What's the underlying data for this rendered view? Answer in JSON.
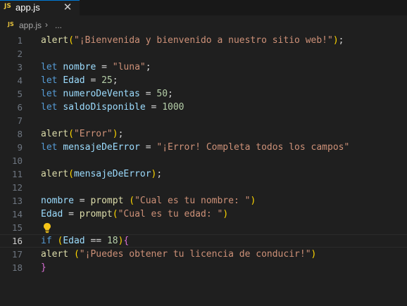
{
  "tab": {
    "badge": "JS",
    "name": "app.js",
    "close": "✕"
  },
  "breadcrumb": {
    "badge": "JS",
    "file": "app.js",
    "separator": "›",
    "more": "..."
  },
  "editor": {
    "current_line": 16,
    "lines": [
      {
        "n": "1",
        "tokens": [
          [
            "fn",
            "alert"
          ],
          [
            "p1",
            "("
          ],
          [
            "str",
            "\"¡Bienvenida y bienvenido a nuestro sitio web!\""
          ],
          [
            "p1",
            ")"
          ],
          [
            "plain",
            ";"
          ]
        ]
      },
      {
        "n": "2",
        "tokens": []
      },
      {
        "n": "3",
        "tokens": [
          [
            "kw",
            "let"
          ],
          [
            "plain",
            " "
          ],
          [
            "var",
            "nombre"
          ],
          [
            "op",
            " = "
          ],
          [
            "str",
            "\"luna\""
          ],
          [
            "plain",
            ";"
          ]
        ]
      },
      {
        "n": "4",
        "tokens": [
          [
            "kw",
            "let"
          ],
          [
            "plain",
            " "
          ],
          [
            "var",
            "Edad"
          ],
          [
            "op",
            " = "
          ],
          [
            "num",
            "25"
          ],
          [
            "plain",
            ";"
          ]
        ]
      },
      {
        "n": "5",
        "tokens": [
          [
            "kw",
            "let"
          ],
          [
            "plain",
            " "
          ],
          [
            "var",
            "numeroDeVentas"
          ],
          [
            "op",
            " = "
          ],
          [
            "num",
            "50"
          ],
          [
            "plain",
            ";"
          ]
        ]
      },
      {
        "n": "6",
        "tokens": [
          [
            "kw",
            "let"
          ],
          [
            "plain",
            " "
          ],
          [
            "var",
            "saldoDisponible"
          ],
          [
            "op",
            " = "
          ],
          [
            "num",
            "1000"
          ]
        ]
      },
      {
        "n": "7",
        "tokens": []
      },
      {
        "n": "8",
        "tokens": [
          [
            "fn",
            "alert"
          ],
          [
            "p1",
            "("
          ],
          [
            "str",
            "\"Error\""
          ],
          [
            "p1",
            ")"
          ],
          [
            "plain",
            ";"
          ]
        ]
      },
      {
        "n": "9",
        "tokens": [
          [
            "kw",
            "let"
          ],
          [
            "plain",
            " "
          ],
          [
            "var",
            "mensajeDeError"
          ],
          [
            "op",
            " = "
          ],
          [
            "str",
            "\"¡Error! Completa todos los campos\""
          ]
        ]
      },
      {
        "n": "10",
        "tokens": []
      },
      {
        "n": "11",
        "tokens": [
          [
            "fn",
            "alert"
          ],
          [
            "p1",
            "("
          ],
          [
            "var",
            "mensajeDeError"
          ],
          [
            "p1",
            ")"
          ],
          [
            "plain",
            ";"
          ]
        ]
      },
      {
        "n": "12",
        "tokens": []
      },
      {
        "n": "13",
        "tokens": [
          [
            "var",
            "nombre"
          ],
          [
            "op",
            " = "
          ],
          [
            "fn",
            "prompt"
          ],
          [
            "plain",
            " "
          ],
          [
            "p1",
            "("
          ],
          [
            "str",
            "\"Cual es tu nombre: \""
          ],
          [
            "p1",
            ")"
          ]
        ]
      },
      {
        "n": "14",
        "tokens": [
          [
            "var",
            "Edad"
          ],
          [
            "op",
            " = "
          ],
          [
            "fn",
            "prompt"
          ],
          [
            "p1",
            "("
          ],
          [
            "str",
            "\"Cual es tu edad: \""
          ],
          [
            "p1",
            ")"
          ]
        ]
      },
      {
        "n": "15",
        "tokens": [],
        "bulb": true
      },
      {
        "n": "16",
        "tokens": [
          [
            "kw",
            "if"
          ],
          [
            "plain",
            " "
          ],
          [
            "p1",
            "("
          ],
          [
            "var",
            "Edad"
          ],
          [
            "op",
            " == "
          ],
          [
            "num",
            "18"
          ],
          [
            "p1",
            ")"
          ],
          [
            "p2",
            "{"
          ]
        ]
      },
      {
        "n": "17",
        "tokens": [
          [
            "fn",
            "alert"
          ],
          [
            "plain",
            " "
          ],
          [
            "p1",
            "("
          ],
          [
            "str",
            "\"¡Puedes obtener tu licencia de conducir!\""
          ],
          [
            "p1",
            ")"
          ]
        ]
      },
      {
        "n": "18",
        "tokens": [
          [
            "p2",
            "}"
          ]
        ]
      }
    ]
  },
  "colors": {
    "background": "#1f1f1f",
    "tabbar": "#181818",
    "accent": "#0078d4",
    "js_badge": "#e8c33c"
  }
}
